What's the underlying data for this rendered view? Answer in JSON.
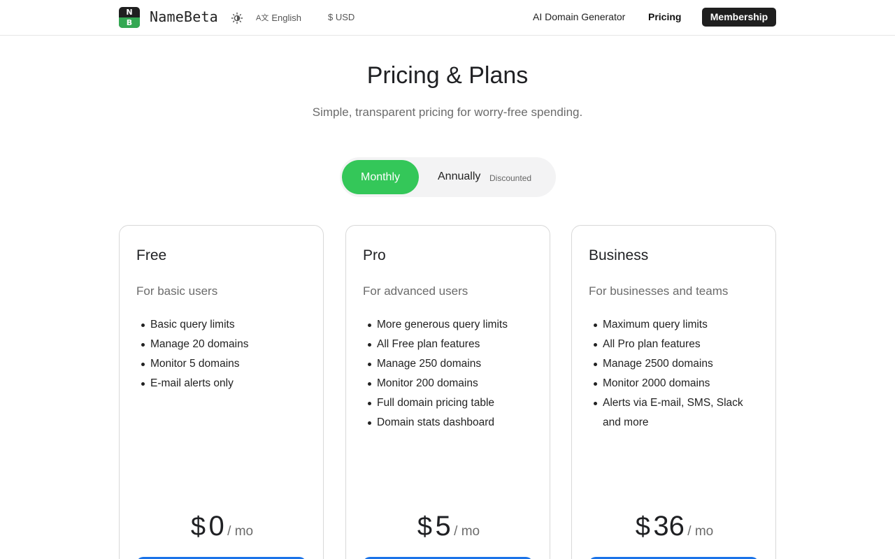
{
  "header": {
    "logo_top": "N",
    "logo_bottom": "B",
    "brand": "NameBeta",
    "language": "English",
    "language_glyph": "A文",
    "currency": "$ USD",
    "nav": {
      "generator": "AI Domain Generator",
      "pricing": "Pricing",
      "membership": "Membership"
    }
  },
  "hero": {
    "title": "Pricing & Plans",
    "subtitle": "Simple, transparent pricing for worry-free spending."
  },
  "billing": {
    "monthly": "Monthly",
    "annually": "Annually",
    "discount_badge": "Discounted",
    "selected": "Monthly"
  },
  "plans": [
    {
      "name": "Free",
      "description": "For basic users",
      "features": [
        "Basic query limits",
        "Manage 20 domains",
        "Monitor 5 domains",
        "E-mail alerts only"
      ],
      "currency": "$",
      "price": "0",
      "period": "/ mo"
    },
    {
      "name": "Pro",
      "description": "For advanced users",
      "features": [
        "More generous query limits",
        "All Free plan features",
        "Manage 250 domains",
        "Monitor 200 domains",
        "Full domain pricing table",
        "Domain stats dashboard"
      ],
      "currency": "$",
      "price": "5",
      "period": "/ mo"
    },
    {
      "name": "Business",
      "description": "For businesses and teams",
      "features": [
        "Maximum query limits",
        "All Pro plan features",
        "Manage 2500 domains",
        "Monitor 2000 domains",
        "Alerts via E-mail, SMS, Slack and more"
      ],
      "currency": "$",
      "price": "36",
      "period": "/ mo"
    }
  ],
  "colors": {
    "accent_green": "#34c759",
    "cta_blue": "#1a73e8",
    "dark": "#1f1f1f"
  }
}
